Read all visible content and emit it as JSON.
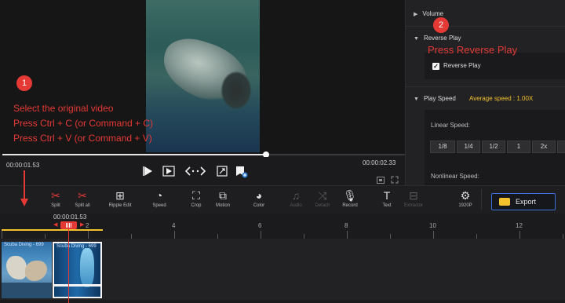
{
  "preview": {
    "current_time": "00:00:01.53",
    "total_time": "00:00:02.33",
    "progress": 0.655
  },
  "right_panel": {
    "volume_label": "Volume",
    "reverse_play_header": "Reverse Play",
    "reverse_play_checkbox_label": "Reverse Play",
    "reverse_play_checked": true,
    "play_speed_label": "Play Speed",
    "average_speed": "Average speed : 1.00X",
    "linear_speed_label": "Linear Speed:",
    "speed_options": [
      "1/8",
      "1/4",
      "1/2",
      "1",
      "2x"
    ],
    "nonlinear_speed_label": "Nonlinear Speed:"
  },
  "toolbar": {
    "items": [
      {
        "label": "Split",
        "icon": "scissors-icon"
      },
      {
        "label": "Split all",
        "icon": "split-all-icon"
      },
      {
        "label": "Ripple Edit",
        "icon": "ripple-edit-icon"
      },
      {
        "label": "Speed",
        "icon": "speedometer-icon"
      },
      {
        "label": "Crop",
        "icon": "crop-icon"
      },
      {
        "label": "Motion",
        "icon": "motion-icon"
      },
      {
        "label": "Color",
        "icon": "palette-icon"
      },
      {
        "label": "Audio",
        "icon": "audio-icon"
      },
      {
        "label": "Detach",
        "icon": "detach-icon"
      },
      {
        "label": "Record",
        "icon": "microphone-icon"
      },
      {
        "label": "Text",
        "icon": "text-icon"
      },
      {
        "label": "Extractor",
        "icon": "extractor-icon"
      },
      {
        "label": "1920P",
        "icon": "resolution-icon"
      }
    ],
    "export_label": "Export"
  },
  "timeline": {
    "playhead_time": "00:00:01.53",
    "ruler_labels": [
      "2",
      "4",
      "6",
      "8",
      "10",
      "12"
    ],
    "clips": [
      {
        "title": "Scuba Diving - 699"
      },
      {
        "title": "Scuba Diving - 699"
      }
    ]
  },
  "annotations": {
    "step1_number": "1",
    "step1_lines": [
      "Select the original video",
      "Press Ctrl + C (or Command + C)",
      "Press Ctrl + V (or Command + V)"
    ],
    "step2_number": "2",
    "step2_text": "Press Reverse Play"
  },
  "colors": {
    "accent_red": "#e53935",
    "average_speed_color": "#f2c12e",
    "export_border": "#3c6fd8"
  }
}
